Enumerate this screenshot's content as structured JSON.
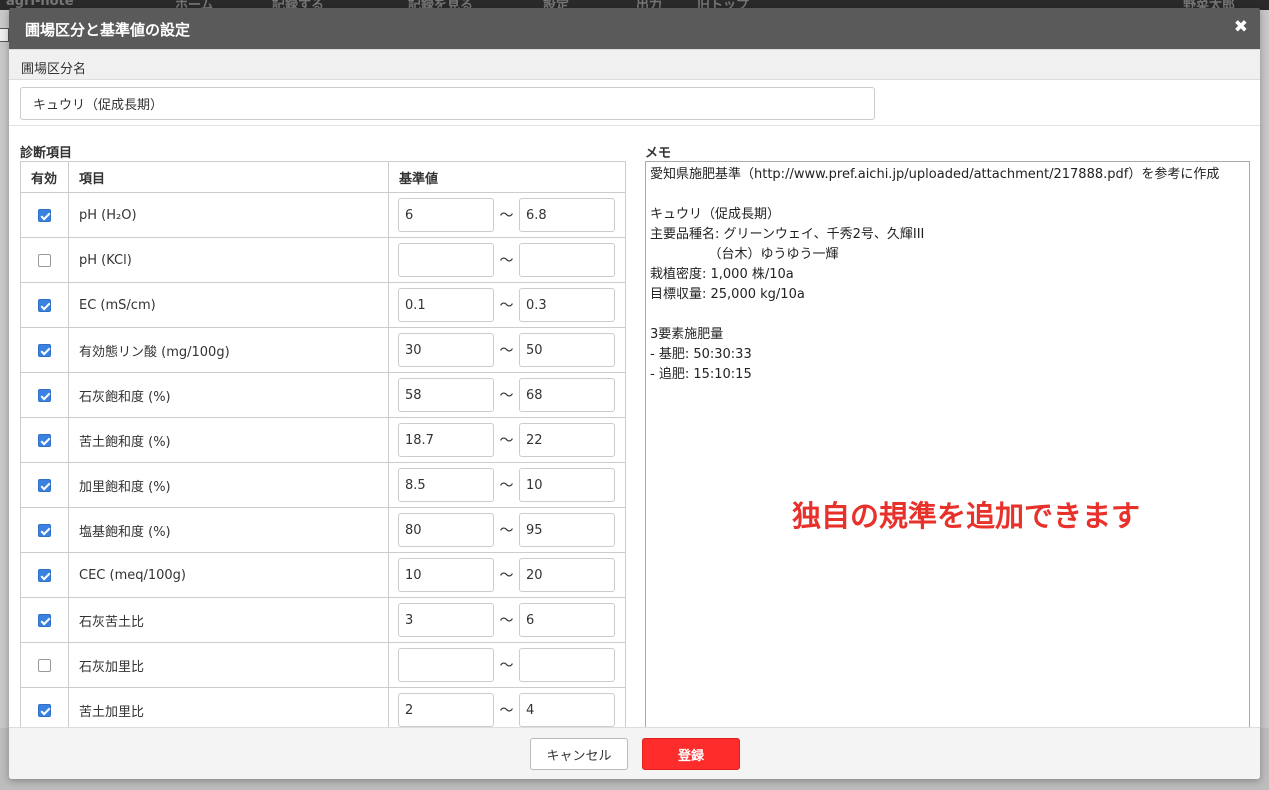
{
  "background": {
    "nav_items": [
      "agri-note",
      "ホーム",
      "記録する",
      "記録を見る",
      "設定",
      "出力",
      "旧トップ",
      "野菜太郎"
    ]
  },
  "modal": {
    "title": "圃場区分と基準値の設定",
    "close_symbol": "✖",
    "section_label": "圃場区分名",
    "name_value": "キュウリ（促成長期）",
    "diagnosis_label": "診断項目",
    "memo_label": "メモ",
    "table": {
      "headers": [
        "有効",
        "項目",
        "基準値"
      ],
      "tilde": "〜",
      "rows": [
        {
          "enabled": true,
          "name": "pH (H₂O)",
          "min": "6",
          "max": "6.8"
        },
        {
          "enabled": false,
          "name": "pH (KCl)",
          "min": "",
          "max": ""
        },
        {
          "enabled": true,
          "name": "EC (mS/cm)",
          "min": "0.1",
          "max": "0.3"
        },
        {
          "enabled": true,
          "name": "有効態リン酸 (mg/100g)",
          "min": "30",
          "max": "50"
        },
        {
          "enabled": true,
          "name": "石灰飽和度 (%)",
          "min": "58",
          "max": "68"
        },
        {
          "enabled": true,
          "name": "苦土飽和度 (%)",
          "min": "18.7",
          "max": "22"
        },
        {
          "enabled": true,
          "name": "加里飽和度 (%)",
          "min": "8.5",
          "max": "10"
        },
        {
          "enabled": true,
          "name": "塩基飽和度 (%)",
          "min": "80",
          "max": "95"
        },
        {
          "enabled": true,
          "name": "CEC (meq/100g)",
          "min": "10",
          "max": "20"
        },
        {
          "enabled": true,
          "name": "石灰苦土比",
          "min": "3",
          "max": "6"
        },
        {
          "enabled": false,
          "name": "石灰加里比",
          "min": "",
          "max": ""
        },
        {
          "enabled": true,
          "name": "苦土加里比",
          "min": "2",
          "max": "4"
        }
      ]
    },
    "memo_lines": [
      "愛知県施肥基準（http://www.pref.aichi.jp/uploaded/attachment/217888.pdf）を参考に作成",
      "",
      "キュウリ（促成長期）",
      "主要品種名: グリーンウェイ、千秀2号、久輝III",
      "　　　　　（台木）ゆうゆう一輝",
      "栽植密度: 1,000 株/10a",
      "目標収量: 25,000 kg/10a",
      "",
      "3要素施肥量",
      "- 基肥: 50:30:33",
      "- 追肥: 15:10:15"
    ],
    "annotation": "独自の規準を追加できます",
    "cancel_label": "キャンセル",
    "submit_label": "登録"
  },
  "colors": {
    "header": "#5a5a5a",
    "checkbox_checked": "#3b82e0",
    "submit": "#ff2c2c",
    "annotation": "#e8312a"
  }
}
